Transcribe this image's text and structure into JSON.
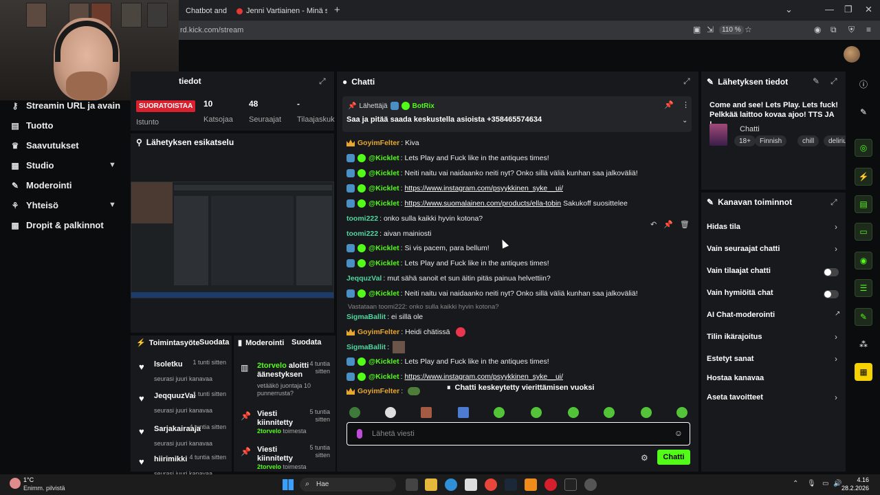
{
  "browser": {
    "tabs": [
      {
        "label": "Chatbot and"
      },
      {
        "label": "Jenni Vartiainen - Minä sinua va"
      }
    ],
    "new_tab": "+",
    "url": "rd.kick.com/stream",
    "zoom": "110 %"
  },
  "nav": {
    "items": [
      {
        "label": "Streamin URL ja avain",
        "icon": "key-icon"
      },
      {
        "label": "Tuotto",
        "icon": "money-icon"
      },
      {
        "label": "Saavutukset",
        "icon": "trophy-icon"
      },
      {
        "label": "Studio",
        "icon": "studio-icon"
      },
      {
        "label": "Moderointi",
        "icon": "wrench-icon"
      },
      {
        "label": "Yhteisö",
        "icon": "community-icon"
      },
      {
        "label": "Dropit & palkinnot",
        "icon": "gift-icon"
      }
    ]
  },
  "stats": {
    "title": "tiedot",
    "live_badge": "SUORATOISTAA",
    "session_label": "Istunto",
    "viewers_value": "10",
    "viewers_label": "Katsojaa",
    "followers_value": "48",
    "followers_label": "Seuraajat",
    "subs_value": "-",
    "subs_label": "Tilaajaskuk"
  },
  "preview": {
    "title": "Lähetyksen esikatselu"
  },
  "activity": {
    "title": "Toimintasyöte",
    "filter": "Suodata",
    "items": [
      {
        "name": "lsoletku",
        "time": "1 tunti sitten",
        "sub": "seurasi juuri kanavaa"
      },
      {
        "name": "JeqquuzVal",
        "time": "1 tunti sitten",
        "sub": "seurasi juuri kanavaa"
      },
      {
        "name": "Sarjakairaaja",
        "time": "4 tuntia sitten",
        "sub": "seurasi juuri kanavaa"
      },
      {
        "name": "hiirimikki",
        "time": "4 tuntia sitten",
        "sub": "seurasi juuri kanavaa"
      }
    ]
  },
  "modlog": {
    "title": "Moderointi",
    "filter": "Suodata",
    "items": [
      {
        "actor": "2torvelo",
        "action": "aloitti äänestyksen",
        "time": "4 tuntia sitten",
        "sub": "vetääkö juontaja 10 punnerrusta?"
      },
      {
        "actor": "",
        "action": "Viesti kiinnitetty",
        "time": "5 tuntia sitten",
        "sub_actor": "2torvelo",
        "sub": "toimesta"
      },
      {
        "actor": "",
        "action": "Viesti kiinnitetty",
        "time": "5 tuntia sitten",
        "sub_actor": "2torvelo",
        "sub": "toimesta"
      }
    ]
  },
  "chat": {
    "title": "Chatti",
    "pinned": {
      "sender_label": "Lähettäjä",
      "sender": "BotRix",
      "message": "Saa ja pitää saada keskustella asioista +358465574634"
    },
    "messages": [
      {
        "user": "GoyimFelter",
        "badge": "crown",
        "color": "orange",
        "text": "Kiva"
      },
      {
        "user": "@Kicklet",
        "badge": "bot",
        "color": "green",
        "text": "Lets Play and Fuck like in the antiques times!"
      },
      {
        "user": "@Kicklet",
        "badge": "bot",
        "color": "green",
        "text": "Neiti naitu vai naidaanko neiti nyt? Onko sillä väliä kunhan saa jalkoväliä!"
      },
      {
        "user": "@Kicklet",
        "badge": "bot",
        "color": "green",
        "link": "https://www.instagram.com/psyykkinen_syke__ui/",
        "text": ""
      },
      {
        "user": "@Kicklet",
        "badge": "bot",
        "color": "green",
        "link": "https://www.suomalainen.com/products/ella-tobin",
        "text": "Sakukoff suosittelee"
      },
      {
        "user": "toomi222",
        "badge": "",
        "color": "teal",
        "text": "onko sulla kaikki hyvin kotona?"
      },
      {
        "user": "toomi222",
        "badge": "",
        "color": "teal",
        "text": "aivan mainiosti"
      },
      {
        "user": "@Kicklet",
        "badge": "bot",
        "color": "green",
        "text": "Si vis pacem, para bellum!"
      },
      {
        "user": "@Kicklet",
        "badge": "bot",
        "color": "green",
        "text": "Lets Play and Fuck like in the antiques times!"
      },
      {
        "user": "JeqquzVal",
        "badge": "",
        "color": "teal",
        "text": "mut sähä sanoit et sun äitin pitäs painua helvettiin?"
      },
      {
        "user": "@Kicklet",
        "badge": "bot",
        "color": "green",
        "text": "Neiti naitu vai naidaanko neiti nyt? Onko sillä väliä kunhan saa jalkoväliä!"
      },
      {
        "user": "SigmaBallit",
        "badge": "",
        "color": "teal",
        "text": "ei sillä ole"
      },
      {
        "user": "GoyimFelter",
        "badge": "crown",
        "color": "orange",
        "text": "Heidi chätissä"
      },
      {
        "user": "SigmaBallit",
        "badge": "",
        "color": "teal",
        "text": ""
      },
      {
        "user": "@Kicklet",
        "badge": "bot",
        "color": "green",
        "text": "Lets Play and Fuck like in the antiques times!"
      },
      {
        "user": "@Kicklet",
        "badge": "bot",
        "color": "green",
        "link": "https://www.instagram.com/psyykkinen_syke__ui/",
        "text": ""
      },
      {
        "user": "GoyimFelter",
        "badge": "crown",
        "color": "orange",
        "text": ""
      }
    ],
    "reply_context": "Vastataan toomi222: onko sulla kaikki hyvin kotona?",
    "paused": "Chatti keskeytetty vierittämisen vuoksi",
    "input_placeholder": "Lähetä viesti",
    "send_label": "Chatti"
  },
  "info": {
    "title": "Lähetyksen tiedot",
    "stream_title": "Come and see! Lets Play. Lets fuck! Pelkkää laittoo kovaa ajoo! TTS JA !...",
    "category": "Chatti",
    "tags": [
      "18+",
      "Finnish",
      "chill",
      "deliriu"
    ]
  },
  "actions": {
    "title": "Kanavan toiminnot",
    "items": [
      {
        "label": "Hidas tila",
        "control": "chevron"
      },
      {
        "label": "Vain seuraajat chatti",
        "control": "chevron"
      },
      {
        "label": "Vain tilaajat chatti",
        "control": "toggle",
        "on": false
      },
      {
        "label": "Vain hymiöitä chat",
        "control": "toggle",
        "on": false
      },
      {
        "label": "AI Chat-moderointi",
        "control": "external"
      },
      {
        "label": "Tilin ikärajoitus",
        "control": "chevron"
      },
      {
        "label": "Estetyt sanat",
        "control": "chevron"
      },
      {
        "label": "Hostaa kanavaa",
        "control": "none"
      },
      {
        "label": "Aseta tavoitteet",
        "control": "chevron"
      }
    ]
  },
  "taskbar": {
    "temp": "1°C",
    "weather": "Enimm. pilvistä",
    "search": "Hae",
    "time": "4.16",
    "date": "28.2.2026"
  },
  "colors": {
    "accent": "#53fc18",
    "live": "#d9202e",
    "panel": "#18191c",
    "background": "#0b0c0e"
  }
}
